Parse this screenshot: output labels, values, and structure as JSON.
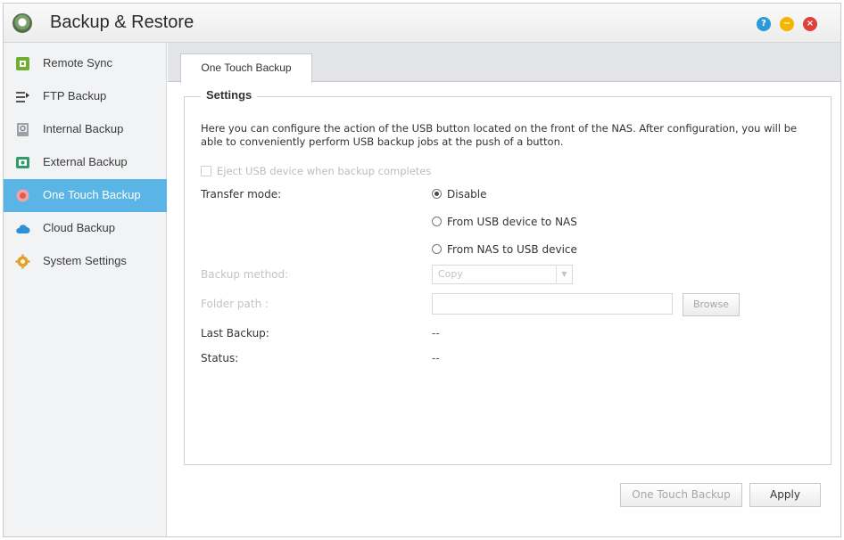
{
  "window": {
    "title": "Backup & Restore"
  },
  "titlebar_buttons": {
    "help": "?",
    "minimize": "−",
    "close": "×"
  },
  "sidebar": {
    "items": [
      {
        "label": "Remote Sync",
        "icon": "remote-sync-icon"
      },
      {
        "label": "FTP Backup",
        "icon": "ftp-backup-icon"
      },
      {
        "label": "Internal Backup",
        "icon": "internal-backup-icon"
      },
      {
        "label": "External Backup",
        "icon": "external-backup-icon"
      },
      {
        "label": "One Touch Backup",
        "icon": "one-touch-backup-icon",
        "active": true
      },
      {
        "label": "Cloud Backup",
        "icon": "cloud-icon"
      },
      {
        "label": "System Settings",
        "icon": "gear-icon"
      }
    ]
  },
  "tabs": [
    {
      "label": "One Touch Backup"
    }
  ],
  "settings": {
    "legend": "Settings",
    "description": "Here you can configure the action of the USB button located on the front of the NAS. After configuration, you will be able to conveniently perform USB backup jobs at the push of a button.",
    "eject_checkbox_label": "Eject USB device when backup completes",
    "transfer_mode_label": "Transfer mode:",
    "transfer_modes": [
      {
        "label": "Disable",
        "checked": true
      },
      {
        "label": "From USB device to NAS",
        "checked": false
      },
      {
        "label": "From NAS to USB device",
        "checked": false
      }
    ],
    "backup_method_label": "Backup method:",
    "backup_method_value": "Copy",
    "folder_path_label": "Folder path :",
    "folder_path_value": "",
    "browse_label": "Browse",
    "last_backup_label": "Last Backup:",
    "last_backup_value": "--",
    "status_label": "Status:",
    "status_value": "--"
  },
  "footer": {
    "one_touch_backup_label": "One Touch Backup",
    "apply_label": "Apply"
  },
  "colors": {
    "active_item": "#5ab4e6",
    "help": "#2b9bd8",
    "minimize": "#f5b400",
    "close": "#e0403a"
  }
}
